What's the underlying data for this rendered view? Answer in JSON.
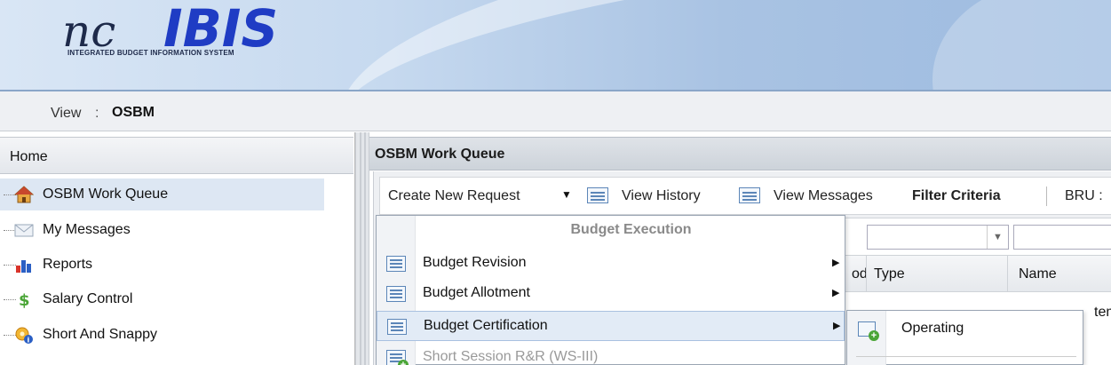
{
  "header": {
    "logo_text_prefix": "nc",
    "logo_text_main": "IBIS",
    "logo_subtitle": "INTEGRATED BUDGET INFORMATION SYSTEM"
  },
  "viewbar": {
    "label": "View",
    "separator": ":",
    "value": "OSBM"
  },
  "left_panel": {
    "title": "Home",
    "items": [
      {
        "label": "OSBM Work Queue",
        "icon": "home-icon",
        "selected": true
      },
      {
        "label": "My Messages",
        "icon": "envelope-icon",
        "selected": false
      },
      {
        "label": "Reports",
        "icon": "bar-chart-icon",
        "selected": false
      },
      {
        "label": "Salary Control",
        "icon": "dollar-icon",
        "selected": false
      },
      {
        "label": "Short And Snappy",
        "icon": "gear-info-icon",
        "selected": false
      }
    ]
  },
  "right_panel": {
    "title": "OSBM Work Queue",
    "toolbar": {
      "create_new_request": "Create New Request",
      "view_history": "View History",
      "view_messages": "View Messages",
      "filter_criteria": "Filter Criteria",
      "bru": "BRU :"
    },
    "grid": {
      "columns": [
        "od",
        "Type",
        "Name"
      ],
      "partial_cell": "tems"
    }
  },
  "dropdown_menu": {
    "group_header": "Budget Execution",
    "items": [
      {
        "label": "Budget Revision",
        "has_submenu": true,
        "disabled": false,
        "highlighted": false
      },
      {
        "label": "Budget Allotment",
        "has_submenu": true,
        "disabled": false,
        "highlighted": false
      },
      {
        "label": "Budget Certification",
        "has_submenu": true,
        "disabled": false,
        "highlighted": true
      },
      {
        "label": "Short Session R&R (WS-III)",
        "has_submenu": false,
        "disabled": true,
        "highlighted": false
      }
    ]
  },
  "submenu": {
    "items": [
      {
        "label": "Operating"
      }
    ]
  },
  "colors": {
    "logo_blue": "#1f3cc4",
    "selection_bg": "#dde7f3",
    "menu_highlight": "#e2ebf6"
  }
}
